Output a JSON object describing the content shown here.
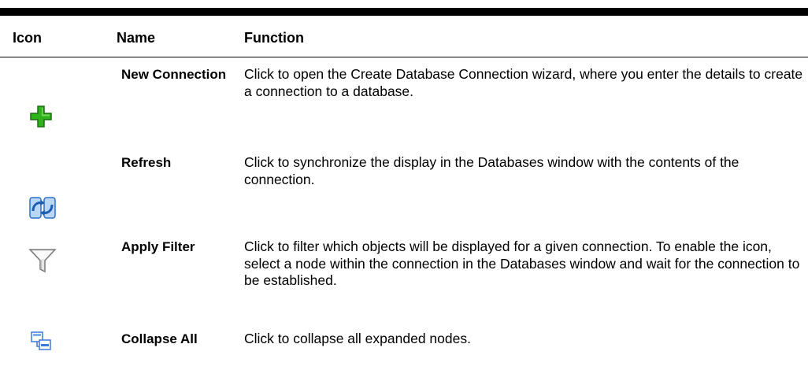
{
  "table": {
    "headers": {
      "icon": "Icon",
      "name": "Name",
      "function": "Function"
    },
    "rows": [
      {
        "icon": "green-plus-icon",
        "name": "New Connection",
        "function": "Click to open the Create Database Connection wizard, where you enter the details to create a connection to a database."
      },
      {
        "icon": "refresh-icon",
        "name": "Refresh",
        "function": "Click to synchronize the display in the Databases window with the contents of the connection."
      },
      {
        "icon": "funnel-filter-icon",
        "name": "Apply Filter",
        "function": "Click to filter which objects will be displayed for a given connection. To enable the icon, select a node within the connection in the Databases window and wait for the connection to be established."
      },
      {
        "icon": "collapse-all-icon",
        "name": "Collapse All",
        "function": "Click to collapse all expanded nodes."
      }
    ]
  },
  "colors": {
    "plus_green": "#2fb21b",
    "refresh_blue": "#2a72c8",
    "filter_gray": "#8e8e8e",
    "collapse_blue": "#3a7bd5"
  }
}
